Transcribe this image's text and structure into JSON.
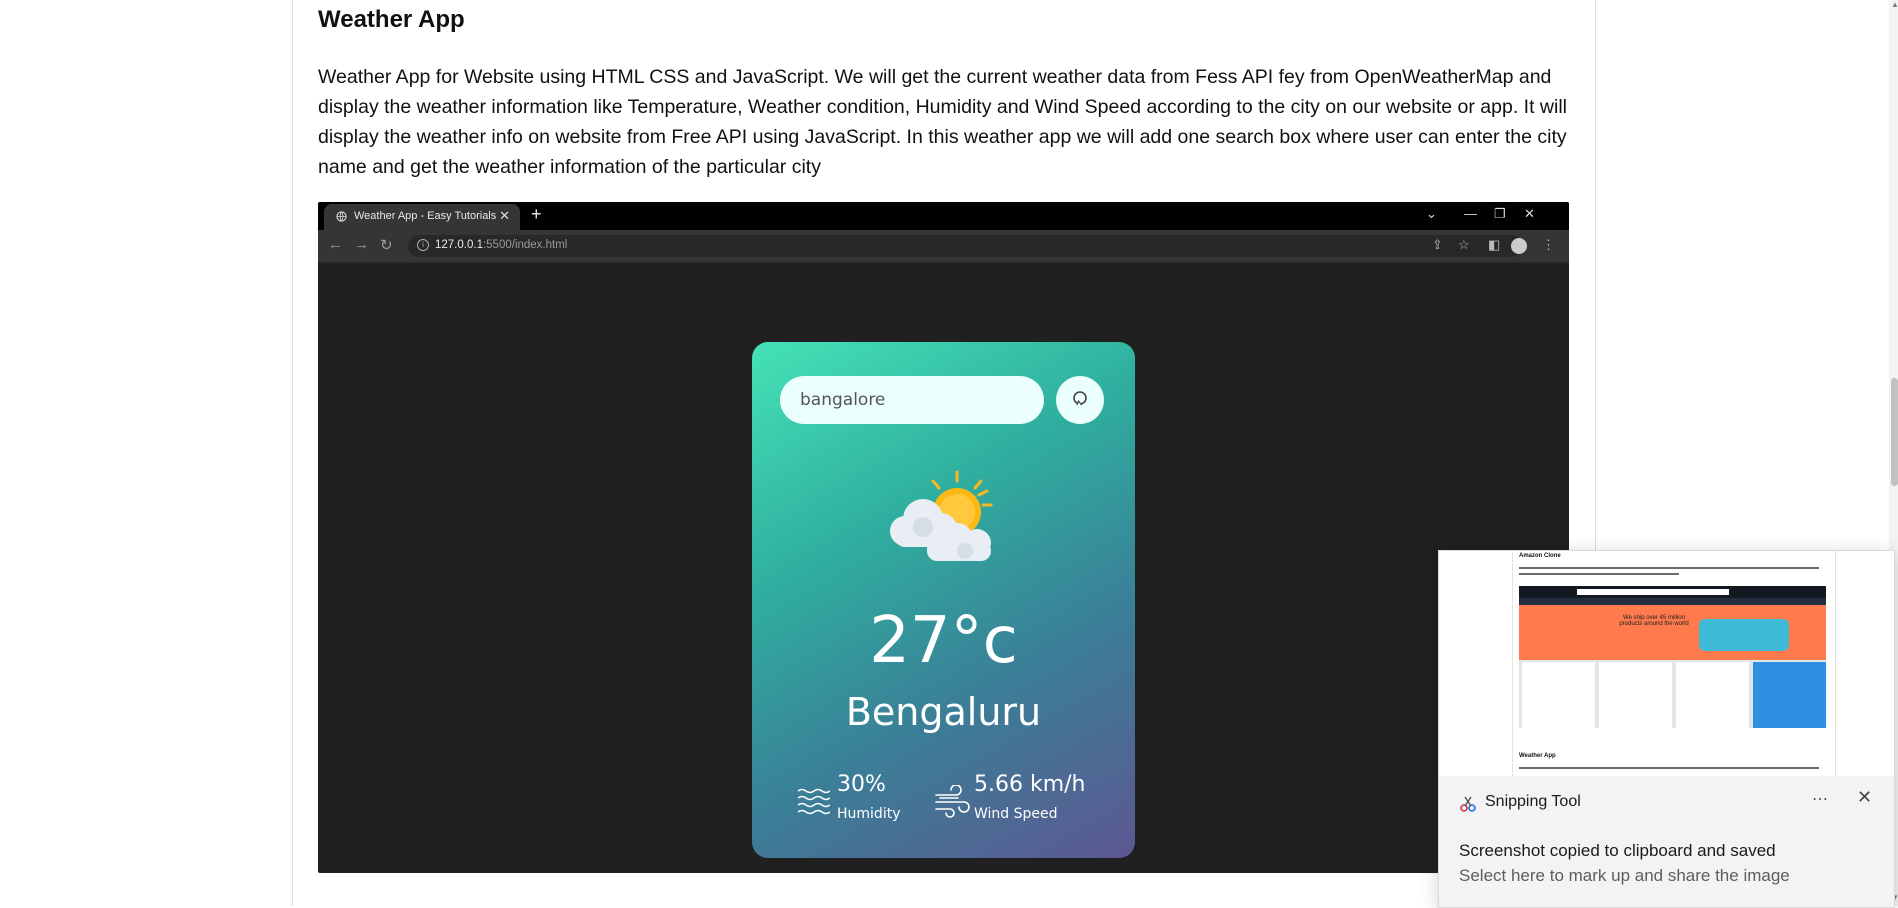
{
  "article": {
    "title": "Weather App",
    "description": "Weather App for Website using HTML CSS and JavaScript. We will get the current weather data from Fess API fey from OpenWeatherMap and display the weather information like Temperature, Weather condition, Humidity and Wind Speed according to the city on our website or app. It will display the weather info on website from Free API using JavaScript. In this weather app we will add one search box where user can enter the city name and get the weather information of the particular city"
  },
  "browser": {
    "tab_title": "Weather App - Easy Tutorials",
    "url_host": "127.0.0.1",
    "url_path": ":5500/index.html"
  },
  "weather": {
    "search_value": "bangalore",
    "temperature": "27°c",
    "city": "Bengaluru",
    "humidity_value": "30%",
    "humidity_label": "Humidity",
    "wind_value": "5.66 km/h",
    "wind_label": "Wind Speed",
    "condition_icon": "partly-cloudy-sun-icon"
  },
  "toast": {
    "app_name": "Snipping Tool",
    "message": "Screenshot copied to clipboard and saved",
    "sub_message": "Select here to mark up and share the image",
    "thumb_heading": "Amazon Clone",
    "thumb_hero": "We ship over 45 million products around the world",
    "thumb_footer_heading": "Weather App"
  },
  "colors": {
    "card_gradient_start": "#45e2b6",
    "card_gradient_end": "#5d5791",
    "browser_bg": "#202020"
  }
}
